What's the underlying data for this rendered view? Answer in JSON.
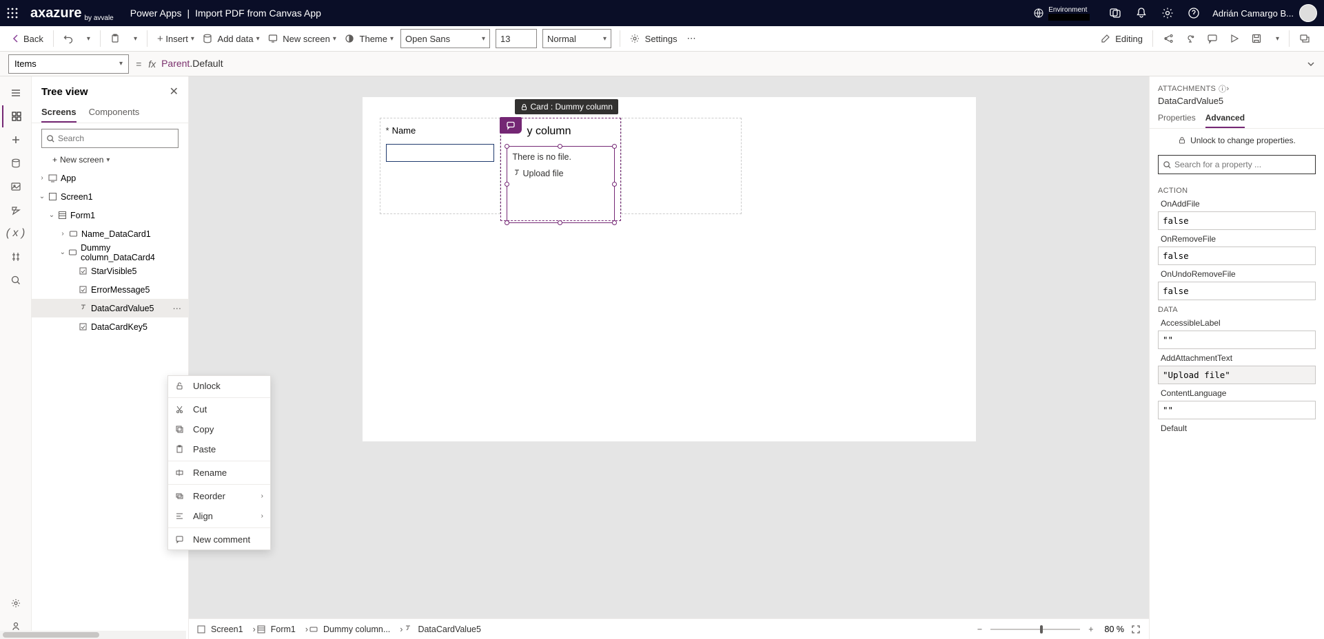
{
  "header": {
    "brand_main": "axazure",
    "brand_sub": "by avvale",
    "app_name": "Power Apps",
    "page_title": "Import PDF from Canvas App",
    "env_label": "Environment",
    "user_name": "Adrián Camargo B..."
  },
  "ribbon": {
    "back": "Back",
    "insert": "Insert",
    "add_data": "Add data",
    "new_screen": "New screen",
    "theme": "Theme",
    "font": "Open Sans",
    "fontsize": "13",
    "weight": "Normal",
    "settings": "Settings",
    "editing": "Editing"
  },
  "formula": {
    "property": "Items",
    "obj": "Parent",
    "dot": ".",
    "member": "Default"
  },
  "tree": {
    "title": "Tree view",
    "tab_screens": "Screens",
    "tab_components": "Components",
    "search_ph": "Search",
    "new_screen": "New screen",
    "nodes": {
      "app": "App",
      "screen1": "Screen1",
      "form1": "Form1",
      "name_dc": "Name_DataCard1",
      "dummy_dc": "Dummy column_DataCard4",
      "star": "StarVisible5",
      "err": "ErrorMessage5",
      "value": "DataCardValue5",
      "key": "DataCardKey5"
    }
  },
  "ctx": {
    "unlock": "Unlock",
    "cut": "Cut",
    "copy": "Copy",
    "paste": "Paste",
    "rename": "Rename",
    "reorder": "Reorder",
    "align": "Align",
    "comment": "New comment"
  },
  "canvas": {
    "name_label": "Name",
    "dummy_label": "y column",
    "card_tooltip": "Card : Dummy column",
    "no_file": "There is no file.",
    "upload": "Upload file"
  },
  "breadcrumb": {
    "screen1": "Screen1",
    "form1": "Form1",
    "dummy": "Dummy column...",
    "value": "DataCardValue5"
  },
  "zoom": {
    "pct": "80 %"
  },
  "props": {
    "type": "ATTACHMENTS",
    "name": "DataCardValue5",
    "tab_props": "Properties",
    "tab_adv": "Advanced",
    "unlock_msg": "Unlock to change properties.",
    "search_ph": "Search for a property ...",
    "cat_action": "ACTION",
    "onadd_lbl": "OnAddFile",
    "onadd_val": "false",
    "onrem_lbl": "OnRemoveFile",
    "onrem_val": "false",
    "onundo_lbl": "OnUndoRemoveFile",
    "onundo_val": "false",
    "cat_data": "DATA",
    "acc_lbl": "AccessibleLabel",
    "acc_val": "\"\"",
    "addtxt_lbl": "AddAttachmentText",
    "addtxt_val": "\"Upload file\"",
    "lang_lbl": "ContentLanguage",
    "lang_val": "\"\"",
    "def_lbl": "Default"
  }
}
